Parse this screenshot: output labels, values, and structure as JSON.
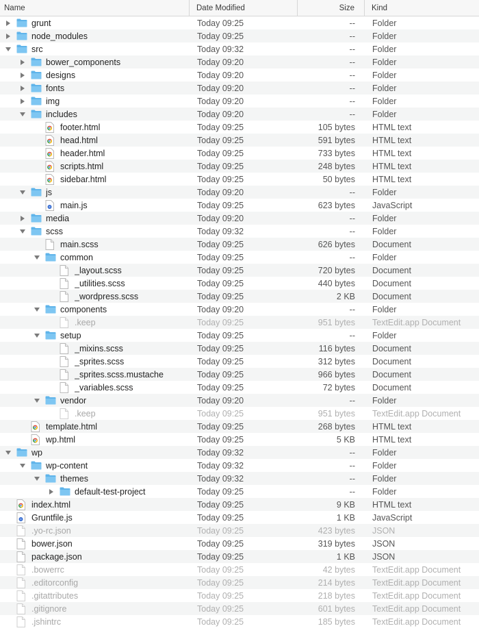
{
  "columns": {
    "name": "Name",
    "date": "Date Modified",
    "size": "Size",
    "kind": "Kind"
  },
  "colors": {
    "folder": "#5fb4ea",
    "folder_tab": "#7ec6f2",
    "row_alt": "#f4f5f5",
    "dim_text": "#a8a8a8"
  },
  "rows": [
    {
      "name": "grunt",
      "date": "Today 09:25",
      "size": "--",
      "kind": "Folder",
      "level": 0,
      "icon": "folder",
      "toggle": "closed"
    },
    {
      "name": "node_modules",
      "date": "Today 09:25",
      "size": "--",
      "kind": "Folder",
      "level": 0,
      "icon": "folder",
      "toggle": "closed"
    },
    {
      "name": "src",
      "date": "Today 09:32",
      "size": "--",
      "kind": "Folder",
      "level": 0,
      "icon": "folder",
      "toggle": "open"
    },
    {
      "name": "bower_components",
      "date": "Today 09:20",
      "size": "--",
      "kind": "Folder",
      "level": 1,
      "icon": "folder",
      "toggle": "closed"
    },
    {
      "name": "designs",
      "date": "Today 09:20",
      "size": "--",
      "kind": "Folder",
      "level": 1,
      "icon": "folder",
      "toggle": "closed"
    },
    {
      "name": "fonts",
      "date": "Today 09:20",
      "size": "--",
      "kind": "Folder",
      "level": 1,
      "icon": "folder",
      "toggle": "closed"
    },
    {
      "name": "img",
      "date": "Today 09:20",
      "size": "--",
      "kind": "Folder",
      "level": 1,
      "icon": "folder",
      "toggle": "closed"
    },
    {
      "name": "includes",
      "date": "Today 09:20",
      "size": "--",
      "kind": "Folder",
      "level": 1,
      "icon": "folder",
      "toggle": "open"
    },
    {
      "name": "footer.html",
      "date": "Today 09:25",
      "size": "105 bytes",
      "kind": "HTML text",
      "level": 2,
      "icon": "html"
    },
    {
      "name": "head.html",
      "date": "Today 09:25",
      "size": "591 bytes",
      "kind": "HTML text",
      "level": 2,
      "icon": "html"
    },
    {
      "name": "header.html",
      "date": "Today 09:25",
      "size": "733 bytes",
      "kind": "HTML text",
      "level": 2,
      "icon": "html"
    },
    {
      "name": "scripts.html",
      "date": "Today 09:25",
      "size": "248 bytes",
      "kind": "HTML text",
      "level": 2,
      "icon": "html"
    },
    {
      "name": "sidebar.html",
      "date": "Today 09:25",
      "size": "50 bytes",
      "kind": "HTML text",
      "level": 2,
      "icon": "html"
    },
    {
      "name": "js",
      "date": "Today 09:20",
      "size": "--",
      "kind": "Folder",
      "level": 1,
      "icon": "folder",
      "toggle": "open"
    },
    {
      "name": "main.js",
      "date": "Today 09:25",
      "size": "623 bytes",
      "kind": "JavaScript",
      "level": 2,
      "icon": "js"
    },
    {
      "name": "media",
      "date": "Today 09:20",
      "size": "--",
      "kind": "Folder",
      "level": 1,
      "icon": "folder",
      "toggle": "closed"
    },
    {
      "name": "scss",
      "date": "Today 09:32",
      "size": "--",
      "kind": "Folder",
      "level": 1,
      "icon": "folder",
      "toggle": "open"
    },
    {
      "name": "main.scss",
      "date": "Today 09:25",
      "size": "626 bytes",
      "kind": "Document",
      "level": 2,
      "icon": "doc"
    },
    {
      "name": "common",
      "date": "Today 09:25",
      "size": "--",
      "kind": "Folder",
      "level": 2,
      "icon": "folder",
      "toggle": "open"
    },
    {
      "name": "_layout.scss",
      "date": "Today 09:25",
      "size": "720 bytes",
      "kind": "Document",
      "level": 3,
      "icon": "doc"
    },
    {
      "name": "_utilities.scss",
      "date": "Today 09:25",
      "size": "440 bytes",
      "kind": "Document",
      "level": 3,
      "icon": "doc"
    },
    {
      "name": "_wordpress.scss",
      "date": "Today 09:25",
      "size": "2 KB",
      "kind": "Document",
      "level": 3,
      "icon": "doc"
    },
    {
      "name": "components",
      "date": "Today 09:20",
      "size": "--",
      "kind": "Folder",
      "level": 2,
      "icon": "folder",
      "toggle": "open"
    },
    {
      "name": ".keep",
      "date": "Today 09:25",
      "size": "951 bytes",
      "kind": "TextEdit.app Document",
      "level": 3,
      "icon": "doc",
      "dim": true
    },
    {
      "name": "setup",
      "date": "Today 09:25",
      "size": "--",
      "kind": "Folder",
      "level": 2,
      "icon": "folder",
      "toggle": "open"
    },
    {
      "name": "_mixins.scss",
      "date": "Today 09:25",
      "size": "116 bytes",
      "kind": "Document",
      "level": 3,
      "icon": "doc"
    },
    {
      "name": "_sprites.scss",
      "date": "Today 09:25",
      "size": "312 bytes",
      "kind": "Document",
      "level": 3,
      "icon": "doc"
    },
    {
      "name": "_sprites.scss.mustache",
      "date": "Today 09:25",
      "size": "966 bytes",
      "kind": "Document",
      "level": 3,
      "icon": "doc"
    },
    {
      "name": "_variables.scss",
      "date": "Today 09:25",
      "size": "72 bytes",
      "kind": "Document",
      "level": 3,
      "icon": "doc"
    },
    {
      "name": "vendor",
      "date": "Today 09:20",
      "size": "--",
      "kind": "Folder",
      "level": 2,
      "icon": "folder",
      "toggle": "open"
    },
    {
      "name": ".keep",
      "date": "Today 09:25",
      "size": "951 bytes",
      "kind": "TextEdit.app Document",
      "level": 3,
      "icon": "doc",
      "dim": true
    },
    {
      "name": "template.html",
      "date": "Today 09:25",
      "size": "268 bytes",
      "kind": "HTML text",
      "level": 1,
      "icon": "html"
    },
    {
      "name": "wp.html",
      "date": "Today 09:25",
      "size": "5 KB",
      "kind": "HTML text",
      "level": 1,
      "icon": "html"
    },
    {
      "name": "wp",
      "date": "Today 09:32",
      "size": "--",
      "kind": "Folder",
      "level": 0,
      "icon": "folder",
      "toggle": "open"
    },
    {
      "name": "wp-content",
      "date": "Today 09:32",
      "size": "--",
      "kind": "Folder",
      "level": 1,
      "icon": "folder",
      "toggle": "open"
    },
    {
      "name": "themes",
      "date": "Today 09:32",
      "size": "--",
      "kind": "Folder",
      "level": 2,
      "icon": "folder",
      "toggle": "open"
    },
    {
      "name": "default-test-project",
      "date": "Today 09:25",
      "size": "--",
      "kind": "Folder",
      "level": 3,
      "icon": "folder",
      "toggle": "closed"
    },
    {
      "name": "index.html",
      "date": "Today 09:25",
      "size": "9 KB",
      "kind": "HTML text",
      "level": 0,
      "icon": "html"
    },
    {
      "name": "Gruntfile.js",
      "date": "Today 09:25",
      "size": "1 KB",
      "kind": "JavaScript",
      "level": 0,
      "icon": "js"
    },
    {
      "name": ".yo-rc.json",
      "date": "Today 09:25",
      "size": "423 bytes",
      "kind": "JSON",
      "level": 0,
      "icon": "doc",
      "dim": true
    },
    {
      "name": "bower.json",
      "date": "Today 09:25",
      "size": "319 bytes",
      "kind": "JSON",
      "level": 0,
      "icon": "doc"
    },
    {
      "name": "package.json",
      "date": "Today 09:25",
      "size": "1 KB",
      "kind": "JSON",
      "level": 0,
      "icon": "doc"
    },
    {
      "name": ".bowerrc",
      "date": "Today 09:25",
      "size": "42 bytes",
      "kind": "TextEdit.app Document",
      "level": 0,
      "icon": "doc",
      "dim": true
    },
    {
      "name": ".editorconfig",
      "date": "Today 09:25",
      "size": "214 bytes",
      "kind": "TextEdit.app Document",
      "level": 0,
      "icon": "doc",
      "dim": true
    },
    {
      "name": ".gitattributes",
      "date": "Today 09:25",
      "size": "218 bytes",
      "kind": "TextEdit.app Document",
      "level": 0,
      "icon": "doc",
      "dim": true
    },
    {
      "name": ".gitignore",
      "date": "Today 09:25",
      "size": "601 bytes",
      "kind": "TextEdit.app Document",
      "level": 0,
      "icon": "doc",
      "dim": true
    },
    {
      "name": ".jshintrc",
      "date": "Today 09:25",
      "size": "185 bytes",
      "kind": "TextEdit.app Document",
      "level": 0,
      "icon": "doc",
      "dim": true
    }
  ]
}
